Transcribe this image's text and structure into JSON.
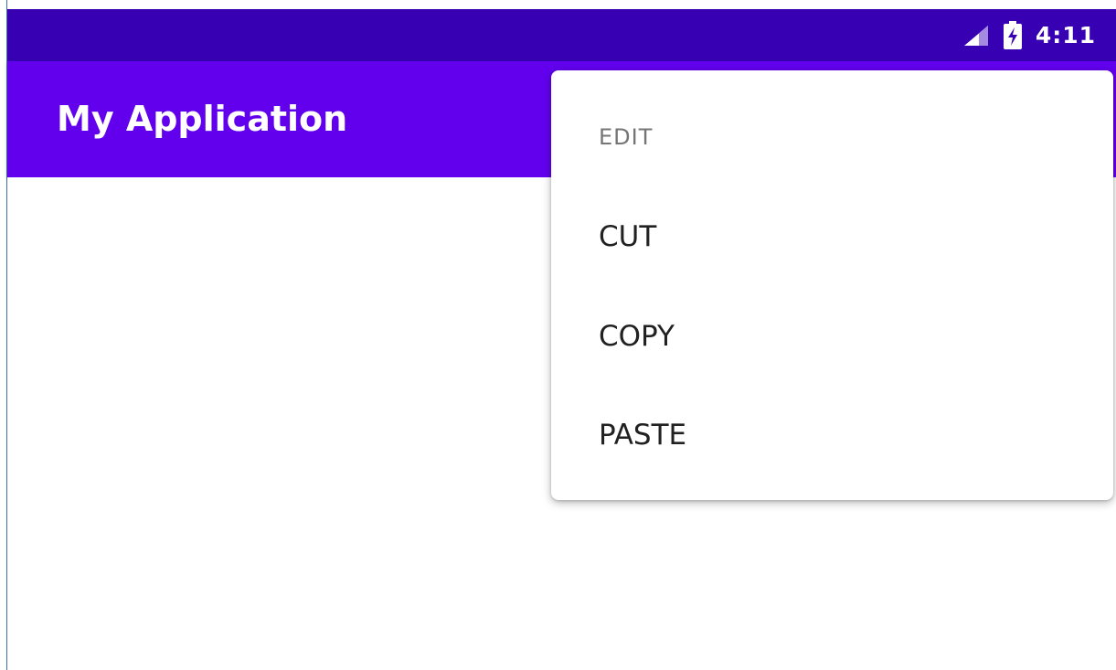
{
  "status_bar": {
    "time": "4:11",
    "icons": [
      "signal-icon",
      "battery-charging-icon"
    ],
    "color": "#3700b3"
  },
  "app_bar": {
    "title": "My Application",
    "color": "#6200ee"
  },
  "context_menu": {
    "header": "EDIT",
    "items": [
      {
        "label": "CUT"
      },
      {
        "label": "COPY"
      },
      {
        "label": "PASTE"
      }
    ]
  }
}
